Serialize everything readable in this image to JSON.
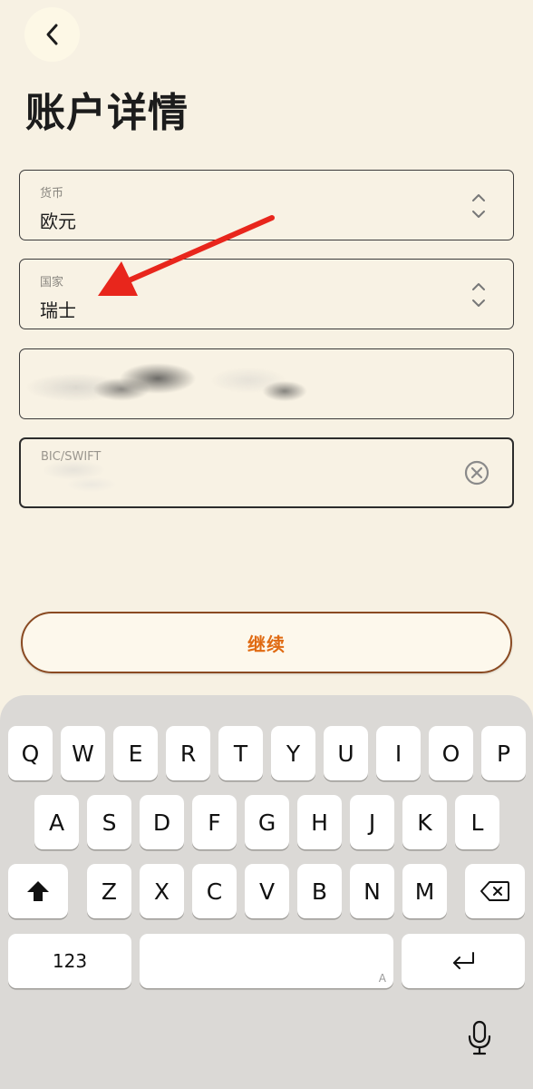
{
  "header": {
    "back_icon": "chevron-left-icon",
    "title": "账户详情"
  },
  "fields": {
    "currency": {
      "label": "货币",
      "value": "欧元",
      "icon": "chevron-updown-icon"
    },
    "country": {
      "label": "国家",
      "value": "瑞士",
      "icon": "chevron-updown-icon"
    },
    "bic": {
      "label": "BIC/SWIFT",
      "icon": "clear-circle-icon"
    }
  },
  "annotation": {
    "type": "arrow",
    "color": "#e8261c"
  },
  "continue_label": "继续",
  "colors": {
    "background": "#f7f1e3",
    "accent": "#e06a12",
    "button_border": "#8a4a22",
    "keyboard": "#dbd9d6"
  },
  "keyboard": {
    "row1": [
      "Q",
      "W",
      "E",
      "R",
      "T",
      "Y",
      "U",
      "I",
      "O",
      "P"
    ],
    "row2": [
      "A",
      "S",
      "D",
      "F",
      "G",
      "H",
      "J",
      "K",
      "L"
    ],
    "row3": [
      "Z",
      "X",
      "C",
      "V",
      "B",
      "N",
      "M"
    ],
    "numbers_label": "123",
    "space_hint": "A",
    "shift_icon": "shift-icon",
    "delete_icon": "delete-icon",
    "return_icon": "return-icon",
    "mic_icon": "microphone-icon"
  }
}
